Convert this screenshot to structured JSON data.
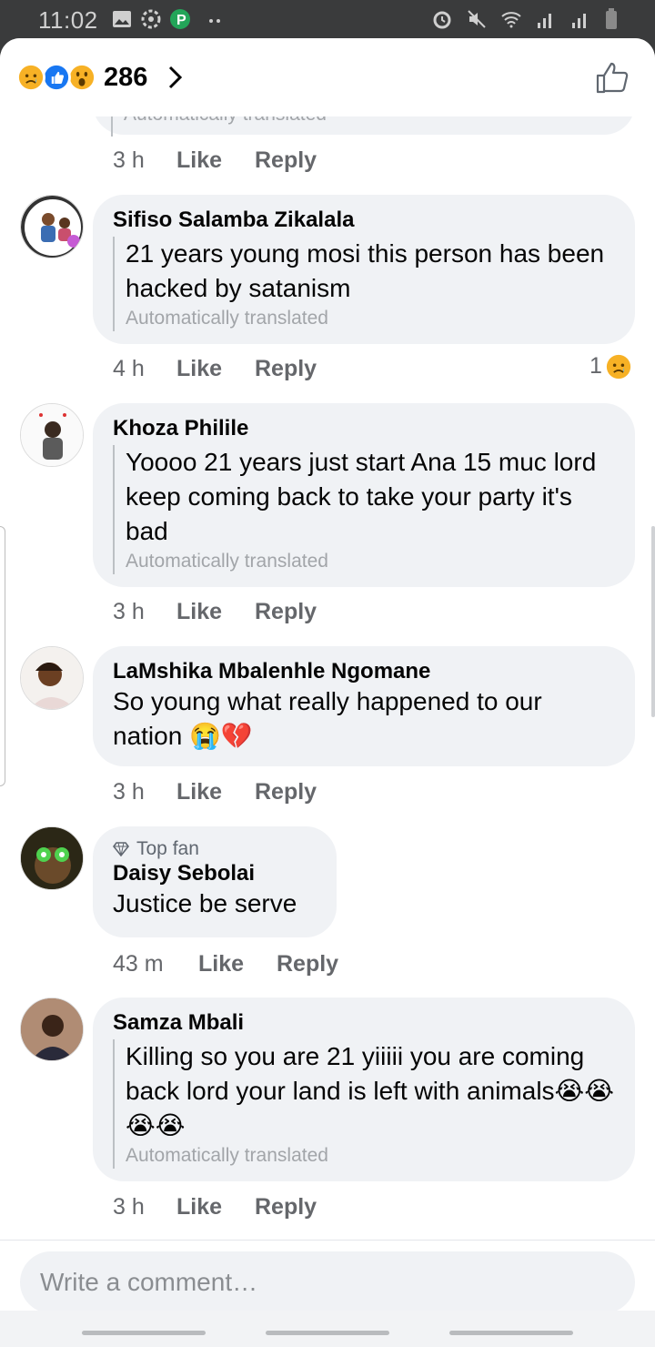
{
  "status_bar": {
    "time": "11:02"
  },
  "header": {
    "reaction_icons": [
      "sad-react-icon",
      "like-react-icon",
      "wow-react-icon"
    ],
    "reaction_count": "286"
  },
  "top_partial": {
    "translated_label": "Automatically translated",
    "time": "3 h",
    "like": "Like",
    "reply": "Reply"
  },
  "comments": [
    {
      "author": "Sifiso Salamba Zikalala",
      "text": "21 years young mosi this person has been hacked by satanism",
      "translated_label": "Automatically translated",
      "time": "4 h",
      "like": "Like",
      "reply": "Reply",
      "reaction_count": "1"
    },
    {
      "author": "Khoza Philile",
      "text": "Yoooo 21 years just start Ana 15 muc lord keep coming back to take your party it's bad",
      "translated_label": "Automatically translated",
      "time": "3 h",
      "like": "Like",
      "reply": "Reply"
    },
    {
      "author": "LaMshika Mbalenhle Ngomane",
      "text": "So young what really happened to our nation 😭💔",
      "time": "3 h",
      "like": "Like",
      "reply": "Reply"
    },
    {
      "badge": "Top fan",
      "author": "Daisy Sebolai",
      "text": "Justice be serve",
      "time": "43 m",
      "like": "Like",
      "reply": "Reply"
    },
    {
      "author": "Samza Mbali",
      "text": "Killing so you are 21 yiiiii you are coming back lord your land is left with animals😭😭😭😭",
      "translated_label": "Automatically translated",
      "time": "3 h",
      "like": "Like",
      "reply": "Reply"
    }
  ],
  "composer": {
    "placeholder": "Write a comment…"
  },
  "colors": {
    "bubble": "#f0f2f5",
    "meta_text": "#65676b",
    "like_blue": "#1877f2",
    "sad_yellow": "#f7b125"
  }
}
